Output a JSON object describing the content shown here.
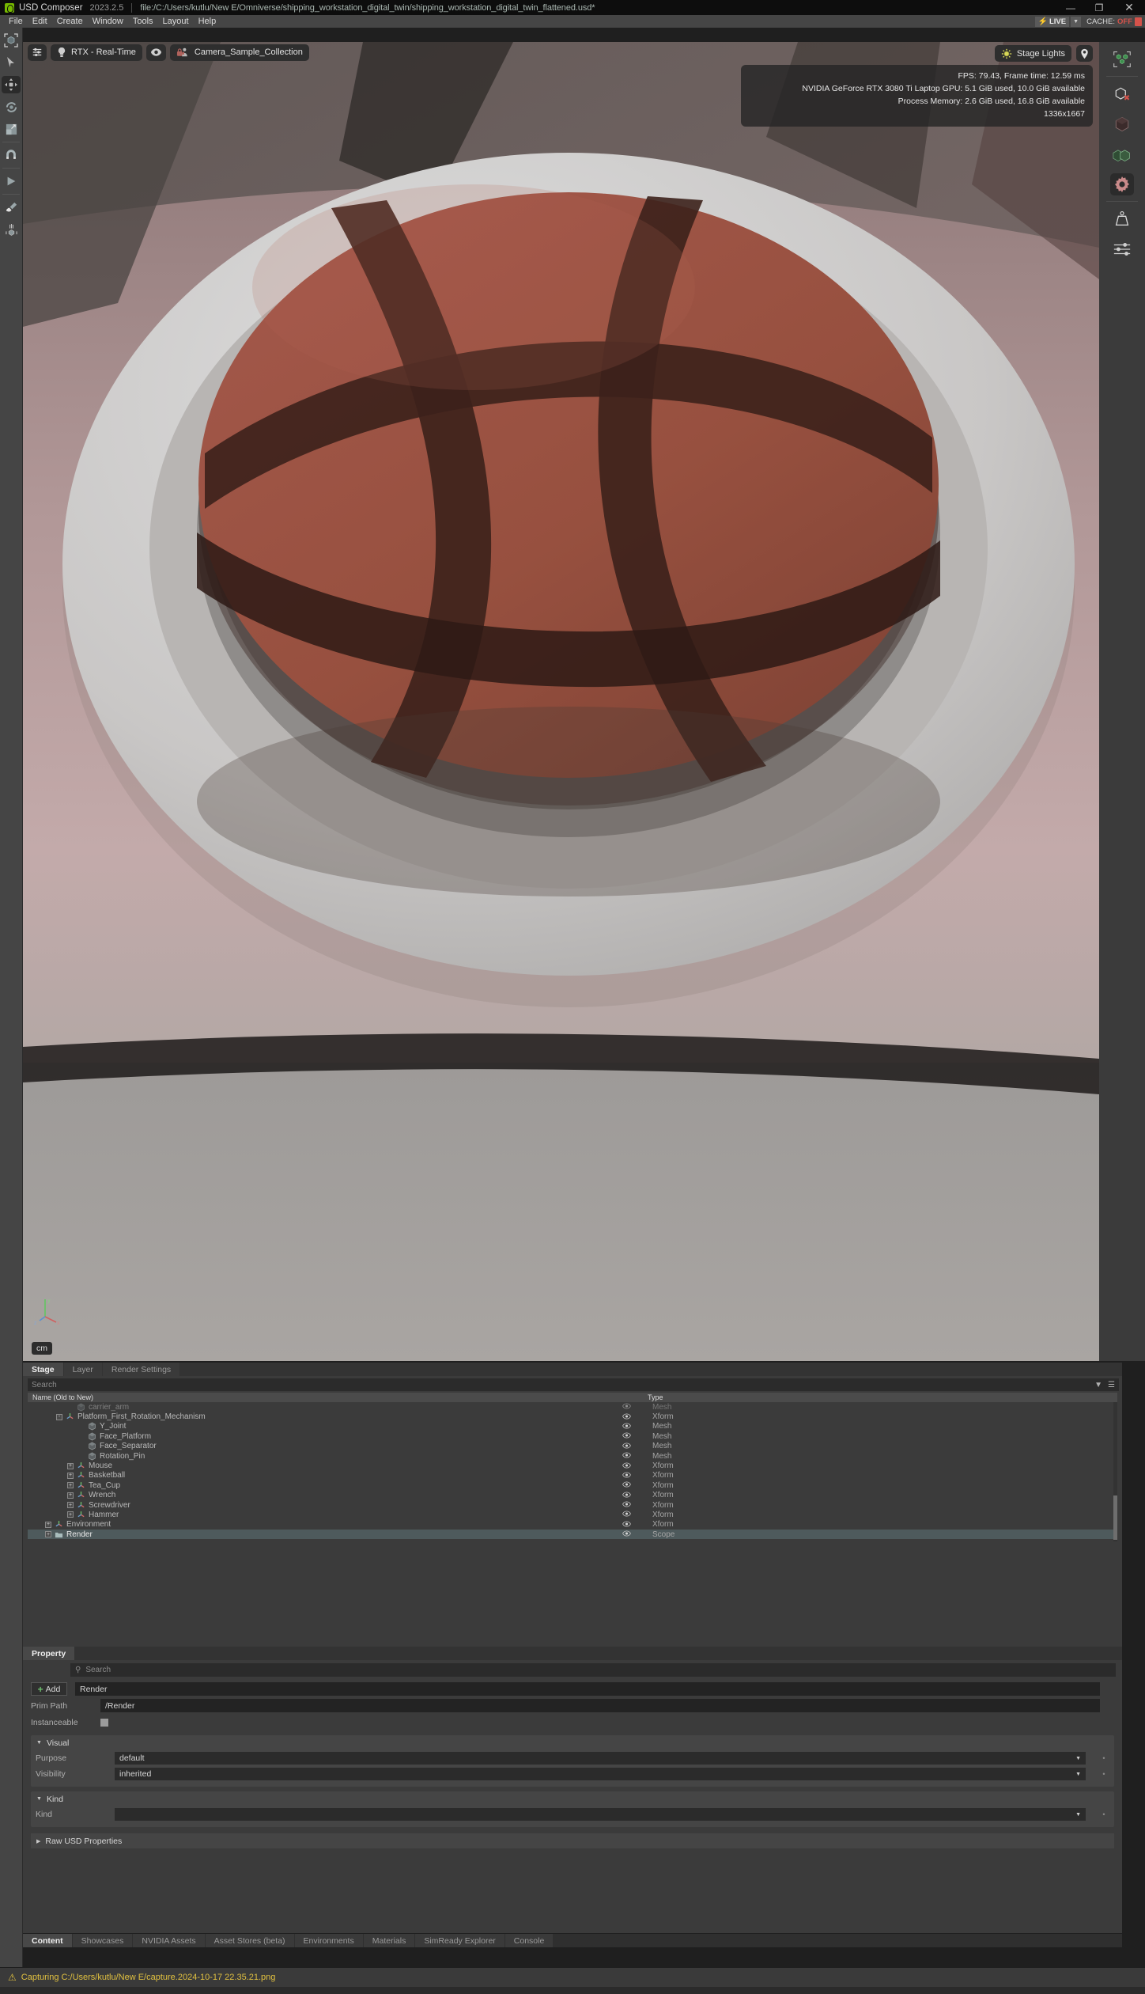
{
  "titlebar": {
    "app_name": "USD Composer",
    "version": "2023.2.5",
    "file_path": "file:/C:/Users/kutlu/New E/Omniverse/shipping_workstation_digital_twin/shipping_workstation_digital_twin_flattened.usd*",
    "minimize": "—",
    "maximize": "❐",
    "close": "✕"
  },
  "menubar": {
    "items": [
      "File",
      "Edit",
      "Create",
      "Window",
      "Tools",
      "Layout",
      "Help"
    ],
    "live_label": "LIVE",
    "live_bolt": "⚡",
    "live_caret": "▼",
    "cache_label": "CACHE:",
    "cache_value": "OFF"
  },
  "left_toolbar": {
    "items": [
      {
        "name": "select-box-icon",
        "glyph": "select-cube"
      },
      {
        "name": "cursor-select-icon",
        "glyph": "cursor"
      },
      {
        "name": "move-tool-icon",
        "glyph": "move",
        "selected": true
      },
      {
        "name": "rotate-tool-icon",
        "glyph": "rotate"
      },
      {
        "name": "scale-tool-icon",
        "glyph": "scale"
      },
      {
        "name": "snap-magnet-icon",
        "glyph": "magnet"
      },
      {
        "name": "play-icon",
        "glyph": "play"
      },
      {
        "name": "paint-brush-icon",
        "glyph": "brush"
      },
      {
        "name": "physics-drop-icon",
        "glyph": "drop"
      }
    ]
  },
  "viewport": {
    "settings_button": "",
    "renderer_label": "RTX - Real-Time",
    "eye_button": "",
    "camera_label": "Camera_Sample_Collection",
    "stage_lights_label": "Stage Lights",
    "location_button": "",
    "stats": [
      "FPS: 79.43, Frame time: 12.59 ms",
      "NVIDIA GeForce RTX 3080 Ti Laptop GPU: 5.1 GiB used, 10.0 GiB available",
      "Process Memory: 2.6 GiB used, 16.8 GiB available",
      "1336x1667"
    ],
    "unit_label": "cm"
  },
  "right_toolbar": {
    "items": [
      {
        "name": "show-by-type-icon",
        "glyph": "cubes-green"
      },
      {
        "name": "hide-object-icon",
        "glyph": "cube-x"
      },
      {
        "name": "dark-cube-icon",
        "glyph": "cube-dark"
      },
      {
        "name": "green-cubes-icon",
        "glyph": "cubes-two"
      },
      {
        "name": "render-settings-gear-icon",
        "glyph": "gear",
        "selected": true
      },
      {
        "name": "physics-weight-icon",
        "glyph": "weight"
      },
      {
        "name": "sliders-icon",
        "glyph": "sliders"
      }
    ]
  },
  "stage_panel": {
    "tabs": [
      {
        "label": "Stage",
        "active": true
      },
      {
        "label": "Layer",
        "active": false
      },
      {
        "label": "Render Settings",
        "active": false
      }
    ],
    "search_placeholder": "Search",
    "filter_icon": "▼",
    "options_icon": "☰",
    "column_name": "Name (Old to New)",
    "column_type": "Type",
    "rows": [
      {
        "label": "carrier_arm",
        "type": "Mesh",
        "indent": 3,
        "expander": "",
        "icon": "mesh",
        "clipped": true,
        "selected": false
      },
      {
        "label": "Platform_First_Rotation_Mechanism",
        "type": "Xform",
        "indent": 2,
        "expander": "-",
        "icon": "xform",
        "selected": false
      },
      {
        "label": "Y_Joint",
        "type": "Mesh",
        "indent": 4,
        "expander": "",
        "icon": "mesh",
        "selected": false
      },
      {
        "label": "Face_Platform",
        "type": "Mesh",
        "indent": 4,
        "expander": "",
        "icon": "mesh",
        "selected": false
      },
      {
        "label": "Face_Separator",
        "type": "Mesh",
        "indent": 4,
        "expander": "",
        "icon": "mesh",
        "selected": false
      },
      {
        "label": "Rotation_Pin",
        "type": "Mesh",
        "indent": 4,
        "expander": "",
        "icon": "mesh",
        "selected": false
      },
      {
        "label": "Mouse",
        "type": "Xform",
        "indent": 3,
        "expander": "+",
        "icon": "xform",
        "selected": false
      },
      {
        "label": "Basketball",
        "type": "Xform",
        "indent": 3,
        "expander": "+",
        "icon": "xform",
        "selected": false
      },
      {
        "label": "Tea_Cup",
        "type": "Xform",
        "indent": 3,
        "expander": "+",
        "icon": "xform",
        "selected": false
      },
      {
        "label": "Wrench",
        "type": "Xform",
        "indent": 3,
        "expander": "+",
        "icon": "xform",
        "selected": false
      },
      {
        "label": "Screwdriver",
        "type": "Xform",
        "indent": 3,
        "expander": "+",
        "icon": "xform",
        "selected": false
      },
      {
        "label": "Hammer",
        "type": "Xform",
        "indent": 3,
        "expander": "+",
        "icon": "xform",
        "selected": false
      },
      {
        "label": "Environment",
        "type": "Xform",
        "indent": 1,
        "expander": "+",
        "icon": "xform",
        "selected": false
      },
      {
        "label": "Render",
        "type": "Scope",
        "indent": 1,
        "expander": "+",
        "icon": "scope",
        "selected": true
      }
    ],
    "eye_glyph": "◉"
  },
  "property_panel": {
    "tab_label": "Property",
    "search_placeholder": "Search",
    "search_icon": "⚲",
    "add_label": "Add",
    "name_value": "Render",
    "prim_path_label": "Prim Path",
    "prim_path_value": "/Render",
    "instanceable_label": "Instanceable",
    "sections": [
      {
        "title": "Visual",
        "expanded": true,
        "rows": [
          {
            "label": "Purpose",
            "value": "default",
            "dropdown": true
          },
          {
            "label": "Visibility",
            "value": "inherited",
            "dropdown": true
          }
        ]
      },
      {
        "title": "Kind",
        "expanded": true,
        "rows": [
          {
            "label": "Kind",
            "value": "",
            "dropdown": true
          }
        ]
      }
    ],
    "raw_usd_label": "Raw USD Properties",
    "caret_down": "▼",
    "caret_right": "▶",
    "dropdown_caret": "▼"
  },
  "bottom_tabs": [
    {
      "label": "Content",
      "active": true
    },
    {
      "label": "Showcases",
      "active": false
    },
    {
      "label": "NVIDIA Assets",
      "active": false
    },
    {
      "label": "Asset Stores (beta)",
      "active": false
    },
    {
      "label": "Environments",
      "active": false
    },
    {
      "label": "Materials",
      "active": false
    },
    {
      "label": "SimReady Explorer",
      "active": false
    },
    {
      "label": "Console",
      "active": false
    }
  ],
  "statusbar": {
    "warning_icon": "⚠",
    "message": "Capturing C:/Users/kutlu/New E/capture.2024-10-17 22.35.21.png"
  },
  "colors": {
    "accent_green": "#76b900",
    "warning_yellow": "#e0c040",
    "cache_red": "#d4524a",
    "selection_blue": "#4e5a5c"
  }
}
